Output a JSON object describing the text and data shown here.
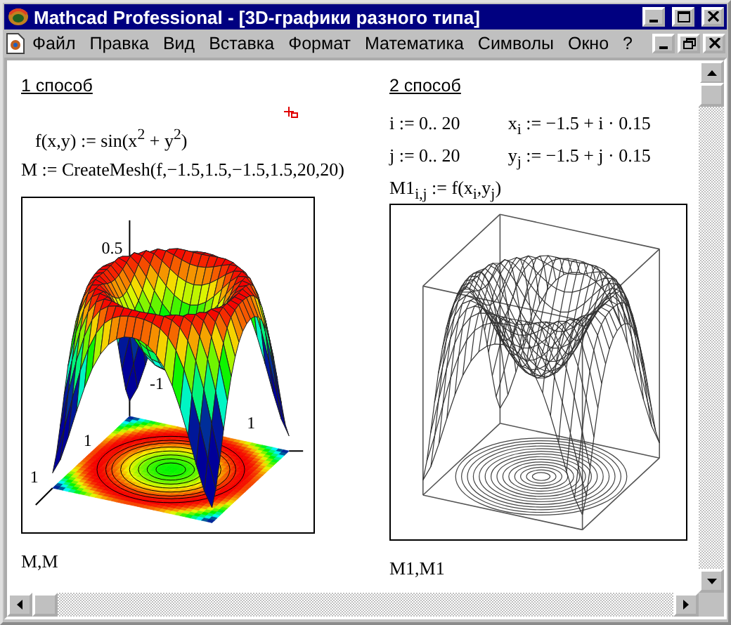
{
  "window": {
    "title": "Mathcad Professional - [3D-графики разного типа]"
  },
  "menu": [
    {
      "label": "Файл"
    },
    {
      "label": "Правка"
    },
    {
      "label": "Вид"
    },
    {
      "label": "Вставка"
    },
    {
      "label": "Формат"
    },
    {
      "label": "Математика"
    },
    {
      "label": "Символы"
    },
    {
      "label": "Окно"
    },
    {
      "label": "?"
    }
  ],
  "sections": [
    {
      "heading": "1 способ",
      "equations": [
        [
          "f(x,y) := sin(x$^{2}$ + y$^{2}$)"
        ],
        [
          "M := CreateMesh(f,−1.5,1.5,−1.5,1.5,20,20)"
        ]
      ],
      "plot": {
        "kind": "colored",
        "tick_labels": [
          "0.5",
          "-1",
          "1",
          "1",
          "1"
        ]
      },
      "caption": "M,M"
    },
    {
      "heading": "2 способ",
      "equations": [
        [
          "i := 0.. 20",
          "x$_{i}$ := −1.5 + i · 0.15"
        ],
        [
          "j := 0.. 20",
          "y$_{j}$ := −1.5 + j · 0.15"
        ],
        [
          "M1$_{i,j}$ := f(x$_{i}$,y$_{j}$)"
        ]
      ],
      "plot": {
        "kind": "wireframe"
      },
      "caption": "M1,M1"
    }
  ]
}
